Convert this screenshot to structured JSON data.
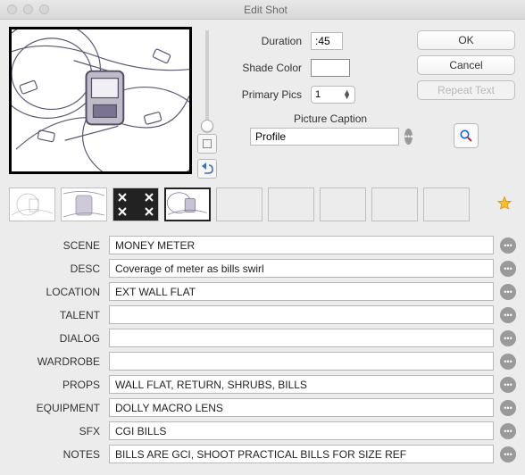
{
  "window": {
    "title": "Edit Shot"
  },
  "shot": {
    "duration_label": "Duration",
    "duration": ":45",
    "shade_label": "Shade Color",
    "shade_color": "#ffffff",
    "primary_label": "Primary Pics",
    "primary_value": "1",
    "caption_label": "Picture Caption",
    "caption": "Profile"
  },
  "buttons": {
    "ok": "OK",
    "cancel": "Cancel",
    "repeat": "Repeat Text"
  },
  "fields": [
    {
      "label": "SCENE",
      "value": "MONEY METER"
    },
    {
      "label": "DESC",
      "value": "Coverage of meter as bills swirl"
    },
    {
      "label": "LOCATION",
      "value": "EXT WALL FLAT"
    },
    {
      "label": "TALENT",
      "value": ""
    },
    {
      "label": "DIALOG",
      "value": ""
    },
    {
      "label": "WARDROBE",
      "value": ""
    },
    {
      "label": "PROPS",
      "value": "WALL FLAT, RETURN, SHRUBS, BILLS"
    },
    {
      "label": "EQUIPMENT",
      "value": "DOLLY MACRO LENS"
    },
    {
      "label": "SFX",
      "value": "CGI BILLS"
    },
    {
      "label": "NOTES",
      "value": "BILLS ARE GCI, SHOOT PRACTICAL BILLS FOR SIZE REF"
    }
  ],
  "thumbs": {
    "count": 9,
    "selected": 3
  }
}
